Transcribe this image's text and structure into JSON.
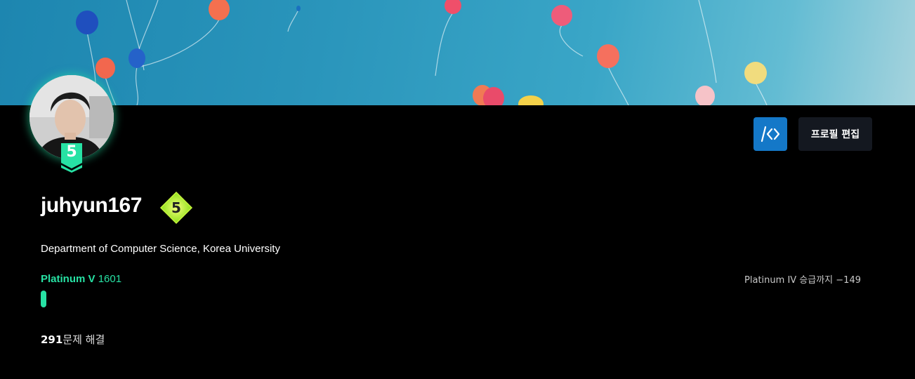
{
  "profile": {
    "username": "juhyun167",
    "bio": "Department of Computer Science, Korea University",
    "avatar_tier_number": "5",
    "class_number": "5"
  },
  "tier": {
    "name": "Platinum V",
    "rating": "1601",
    "next_tier_text": "Platinum IV 승급까지 −149",
    "progress_fraction": 0.006,
    "color": "#27e2a4"
  },
  "solved": {
    "count": "291",
    "label": "문제 해결"
  },
  "actions": {
    "edit_profile": "프로필 편집",
    "solvedac_icon": "code-brackets-icon"
  },
  "colors": {
    "accent_blue": "#1478c8",
    "background": "#000000"
  }
}
